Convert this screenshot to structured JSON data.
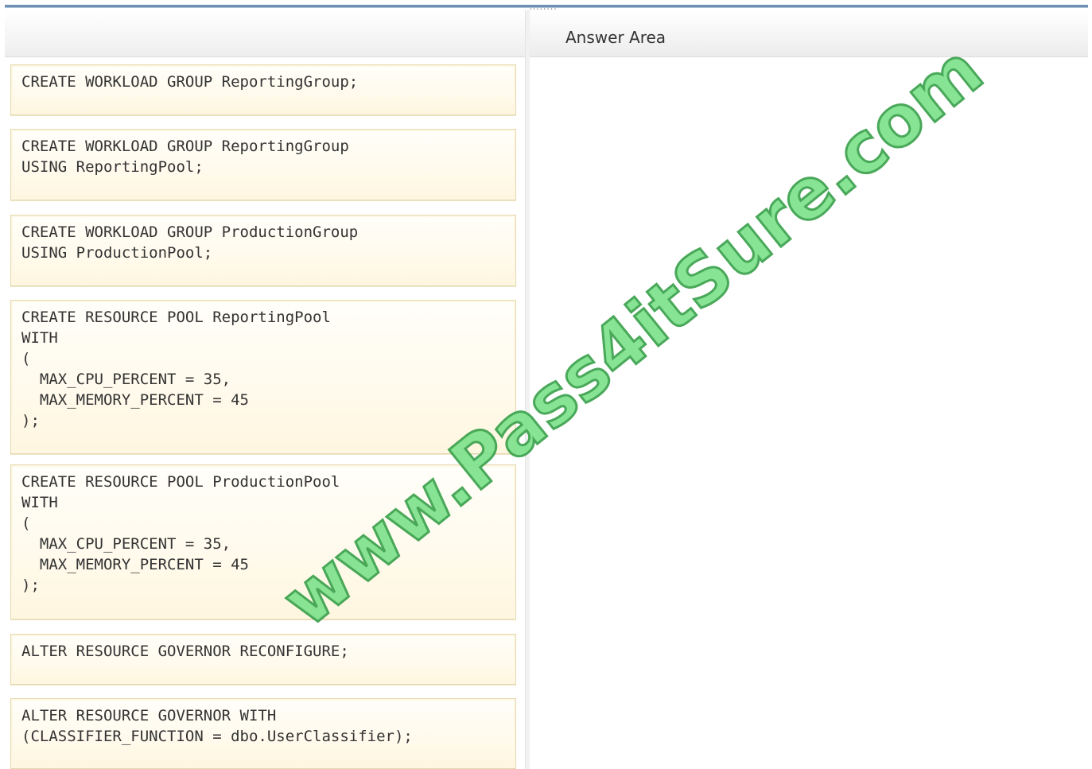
{
  "splitter": {
    "grip": "::::::::"
  },
  "answer_area": {
    "title": "Answer Area"
  },
  "code_blocks": [
    {
      "code": "CREATE WORKLOAD GROUP ReportingGroup;"
    },
    {
      "code": "CREATE WORKLOAD GROUP ReportingGroup\nUSING ReportingPool;"
    },
    {
      "code": "CREATE WORKLOAD GROUP ProductionGroup\nUSING ProductionPool;"
    },
    {
      "code": "CREATE RESOURCE POOL ReportingPool\nWITH\n(\n  MAX_CPU_PERCENT = 35,\n  MAX_MEMORY_PERCENT = 45\n);"
    },
    {
      "code": "CREATE RESOURCE POOL ProductionPool\nWITH\n(\n  MAX_CPU_PERCENT = 35,\n  MAX_MEMORY_PERCENT = 45\n);"
    },
    {
      "code": "ALTER RESOURCE GOVERNOR RECONFIGURE;"
    },
    {
      "code": "ALTER RESOURCE GOVERNOR WITH\n(CLASSIFIER_FUNCTION = dbo.UserClassifier);"
    }
  ],
  "watermark": {
    "text": "www.Pass4itSure.com"
  },
  "colors": {
    "block_background": "#fffaec",
    "block_border": "#e4d8ad",
    "watermark_fill": "#7ee28d",
    "watermark_stroke": "#3aa14c"
  }
}
